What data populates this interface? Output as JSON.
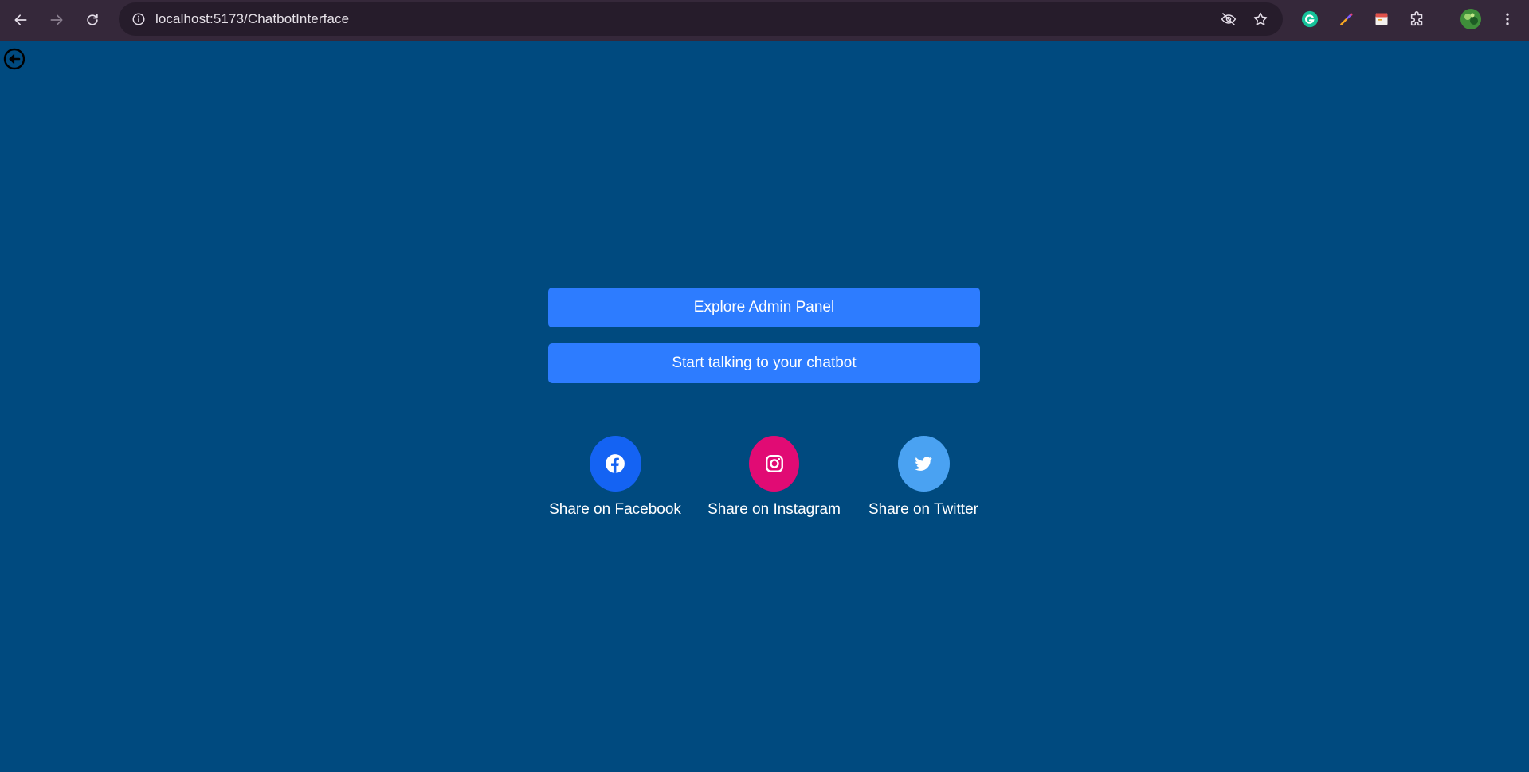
{
  "browser": {
    "url": "localhost:5173/ChatbotInterface",
    "icons": {
      "back": "arrow-left-icon",
      "forward": "arrow-right-icon",
      "reload": "reload-icon",
      "site_info": "info-icon",
      "eye_off": "eye-off-icon",
      "bookmark": "star-icon",
      "extensions": [
        "grammarly-icon",
        "color-picker-icon",
        "notes-icon",
        "puzzle-icon"
      ],
      "profile": "avatar",
      "menu": "more-vert-icon"
    }
  },
  "page": {
    "background": "#004a7f",
    "back_icon": "circle-arrow-left-icon",
    "buttons": {
      "admin_label": "Explore Admin Panel",
      "chat_label": "Start talking to your chatbot",
      "color": "#2d7cff"
    },
    "share": {
      "facebook": {
        "label": "Share on Facebook",
        "icon": "facebook-icon",
        "color": "#1463f3"
      },
      "instagram": {
        "label": "Share on Instagram",
        "icon": "instagram-icon",
        "color": "#e10b74"
      },
      "twitter": {
        "label": "Share on Twitter",
        "icon": "twitter-icon",
        "color": "#4aa2f2"
      }
    }
  }
}
